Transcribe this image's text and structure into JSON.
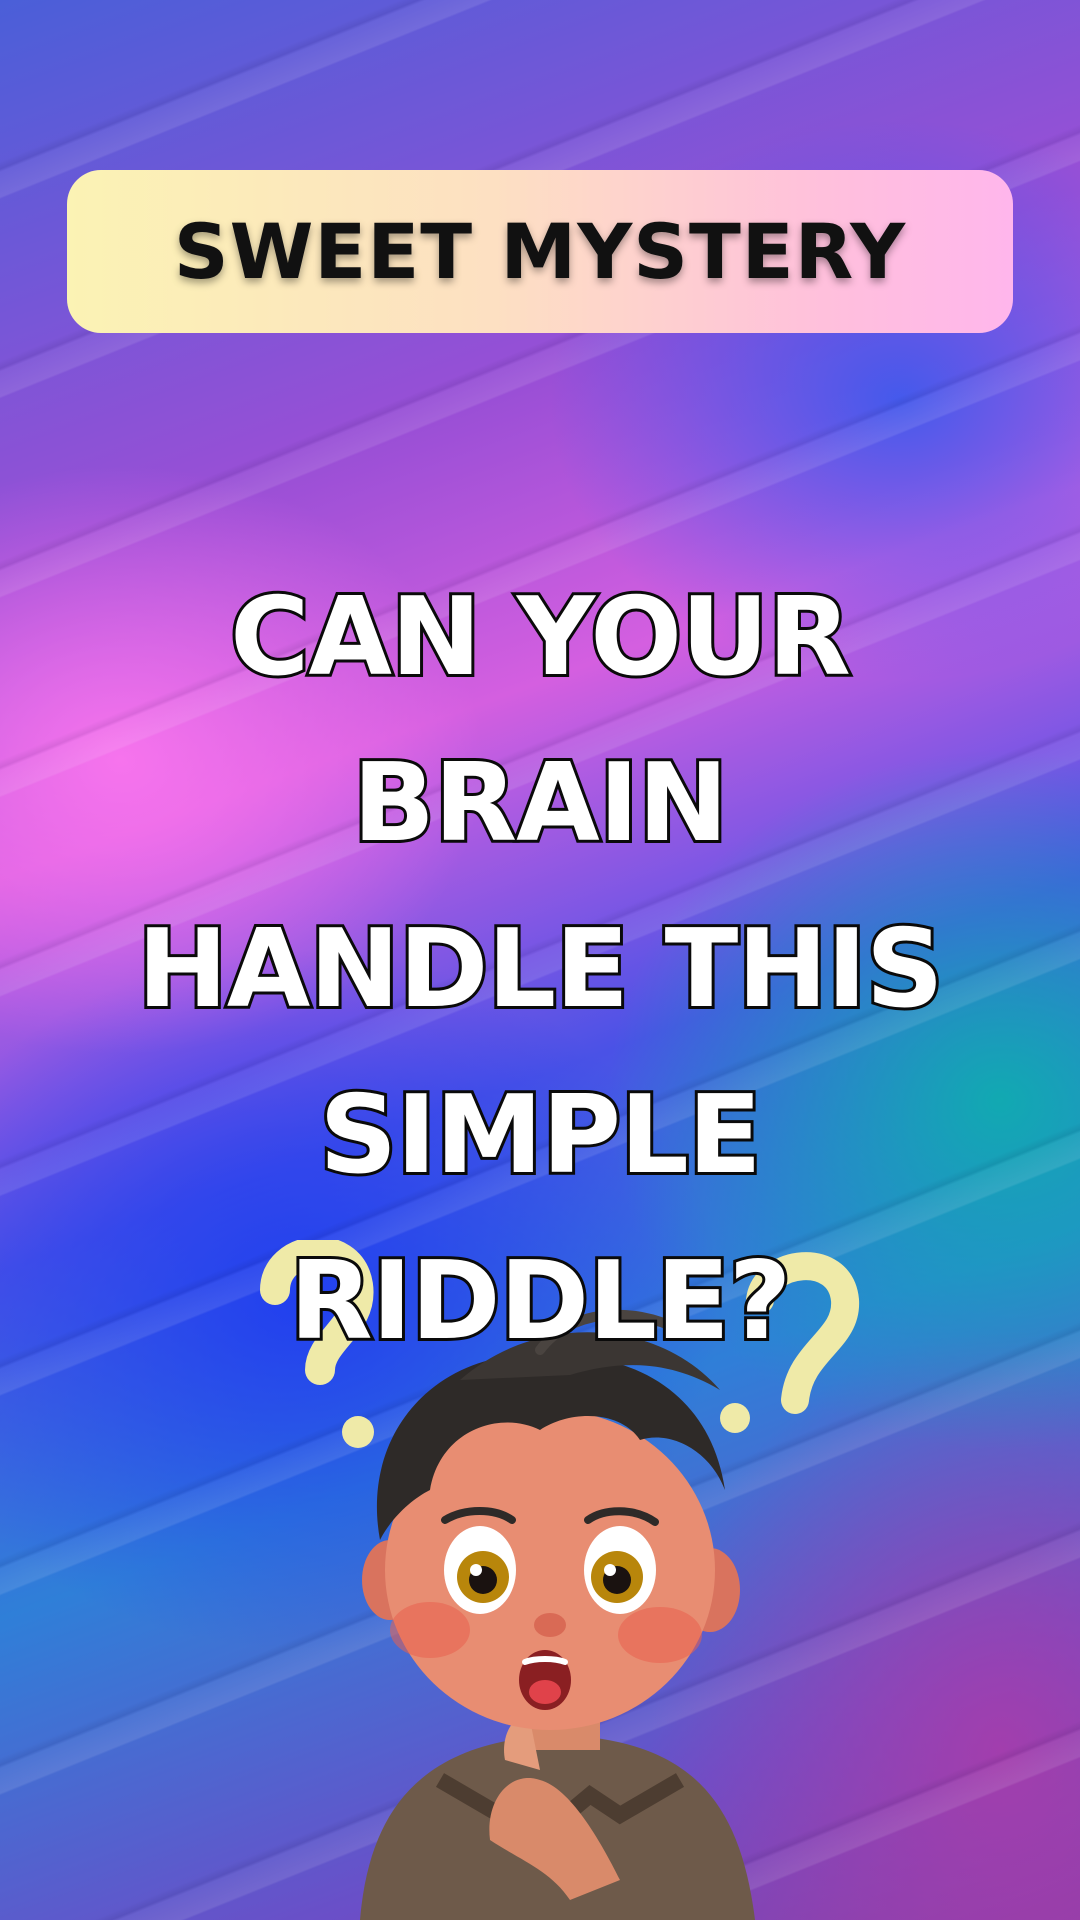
{
  "banner": {
    "title": "SWEET MYSTERY"
  },
  "headline": {
    "lines": [
      "CAN YOUR",
      "BRAIN",
      "HANDLE THIS",
      "SIMPLE",
      "RIDDLE?"
    ]
  },
  "illustration": {
    "icons": [
      "question-mark-icon",
      "question-mark-icon"
    ]
  },
  "colors": {
    "banner_start": "#fbf3b4",
    "banner_end": "#ffb6ec",
    "headline_fill": "#ffffff",
    "headline_stroke": "#0a0a0a",
    "question_mark": "#efeaa8"
  }
}
